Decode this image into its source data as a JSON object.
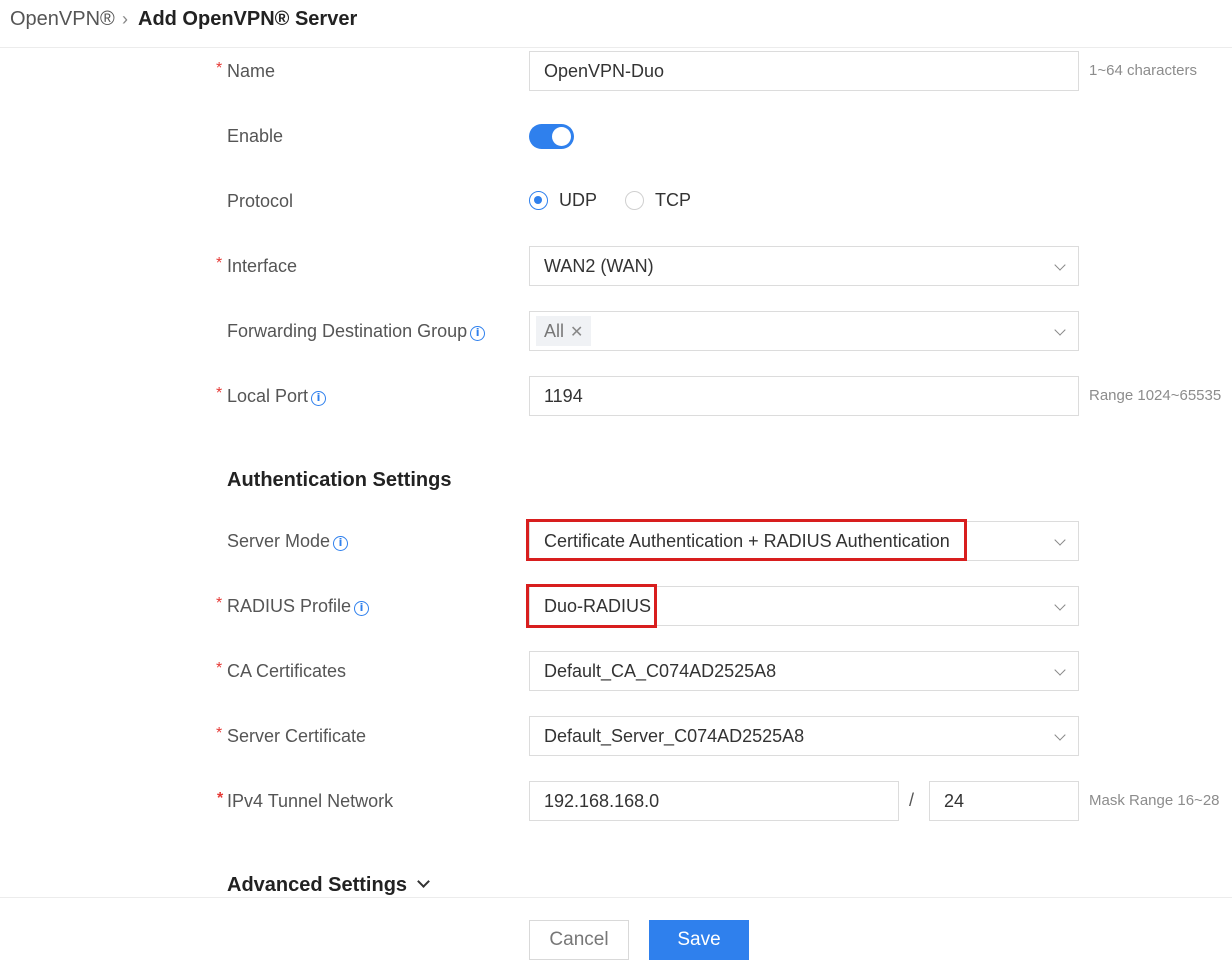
{
  "breadcrumb": {
    "parent": "OpenVPN®",
    "separator": "›",
    "current": "Add OpenVPN® Server"
  },
  "required_mark": "*",
  "info_glyph": "i",
  "form": {
    "name": {
      "label": "Name",
      "value": "OpenVPN-Duo",
      "hint": "1~64 characters"
    },
    "enable": {
      "label": "Enable",
      "checked": true
    },
    "protocol": {
      "label": "Protocol",
      "options": [
        "UDP",
        "TCP"
      ],
      "selected": "UDP"
    },
    "interface": {
      "label": "Interface",
      "value": "WAN2 (WAN)"
    },
    "forwarding_destination_group": {
      "label": "Forwarding Destination Group",
      "tag": "All",
      "tag_close": "✕"
    },
    "local_port": {
      "label": "Local Port",
      "value": "1194",
      "hint": "Range 1024~65535"
    }
  },
  "auth": {
    "title": "Authentication Settings",
    "server_mode": {
      "label": "Server Mode",
      "value": "Certificate Authentication + RADIUS Authentication"
    },
    "radius_profile": {
      "label": "RADIUS Profile",
      "value": "Duo-RADIUS"
    },
    "ca_certificates": {
      "label": "CA Certificates",
      "value": "Default_CA_C074AD2525A8"
    },
    "server_certificate": {
      "label": "Server Certificate",
      "value": "Default_Server_C074AD2525A8"
    },
    "ipv4_tunnel_network": {
      "label": "IPv4 Tunnel Network",
      "ip": "192.168.168.0",
      "separator": "/",
      "mask": "24",
      "hint": "Mask Range 16~28"
    }
  },
  "advanced": {
    "title": "Advanced Settings"
  },
  "footer": {
    "cancel_label": "Cancel",
    "save_label": "Save"
  },
  "colors": {
    "accent": "#2f80ed",
    "required": "#e53935",
    "highlight": "#d81e1e"
  }
}
